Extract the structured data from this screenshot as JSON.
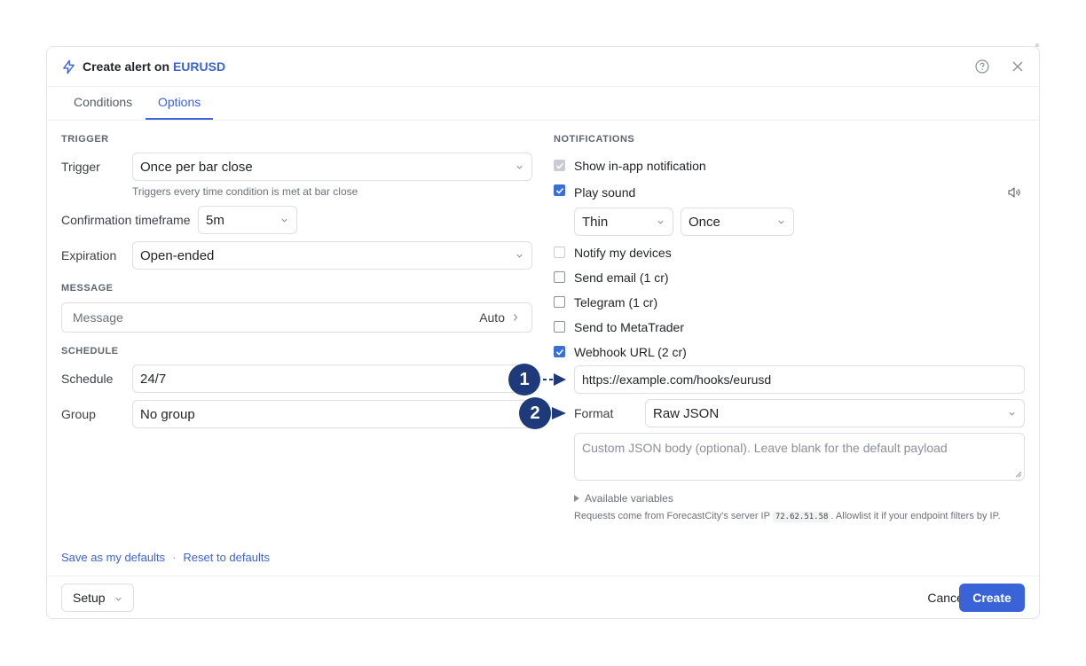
{
  "header": {
    "title_prefix": "Create alert on",
    "symbol": "EURUSD"
  },
  "tabs": [
    {
      "label": "Conditions"
    },
    {
      "label": "Options"
    }
  ],
  "left": {
    "trigger_section": "TRIGGER",
    "trigger_label": "Trigger",
    "trigger_value": "Once per bar close",
    "trigger_hint": "Triggers every time condition is met at bar close",
    "confirmation_label": "Confirmation timeframe",
    "confirmation_value": "5m",
    "expiration_label": "Expiration",
    "expiration_value": "Open-ended",
    "message_section": "MESSAGE",
    "message_placeholder": "Message",
    "message_auto": "Auto",
    "schedule_section": "SCHEDULE",
    "schedule_label": "Schedule",
    "schedule_value": "24/7",
    "group_label": "Group",
    "group_value": "No group"
  },
  "right": {
    "notifications_section": "NOTIFICATIONS",
    "items": [
      {
        "label": "Show in-app notification",
        "checked": true,
        "disabled": true
      },
      {
        "label": "Play sound",
        "checked": true,
        "disabled": false
      },
      {
        "label": "Notify my devices",
        "checked": false,
        "disabled": true
      },
      {
        "label": "Send email (1 cr)",
        "checked": false,
        "disabled": false
      },
      {
        "label": "Telegram (1 cr)",
        "checked": false,
        "disabled": false
      },
      {
        "label": "Send to MetaTrader",
        "checked": false,
        "disabled": false
      },
      {
        "label": "Webhook URL (2 cr)",
        "checked": true,
        "disabled": false
      }
    ],
    "sound_value": "Thin",
    "sound_repeat_value": "Once",
    "webhook_url": "https://example.com/hooks/eurusd",
    "format_label": "Format",
    "format_value": "Raw JSON",
    "json_placeholder": "Custom JSON body (optional). Leave blank for the default payload",
    "available_variables": "Available variables",
    "note_before": "Requests come from ForecastCity's server IP",
    "note_ip": "72.62.51.58",
    "note_after": ". Allowlist it if your endpoint filters by IP."
  },
  "defaults": {
    "save": "Save as my defaults",
    "separator": "·",
    "reset": "Reset to defaults"
  },
  "footer": {
    "setup": "Setup",
    "cancel": "Cancel",
    "create": "Create"
  },
  "markers": [
    "1",
    "2"
  ],
  "colors": {
    "accent": "#3b63d8",
    "marker": "#1e3a7a",
    "checkbox": "#3b6fd8"
  }
}
